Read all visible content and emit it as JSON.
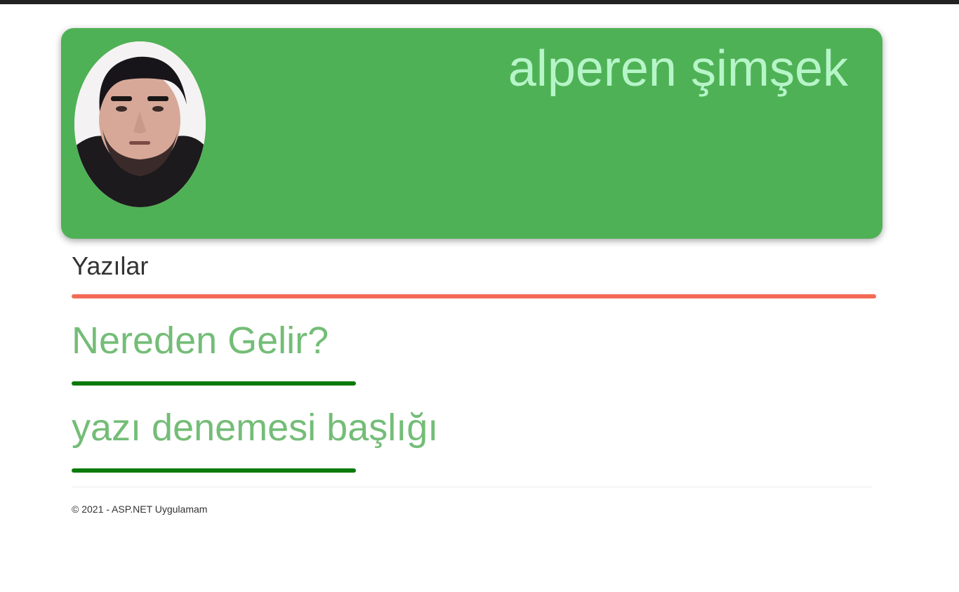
{
  "header": {
    "name": "alperen şimşek",
    "avatar_alt": "profile photo"
  },
  "section": {
    "title": "Yazılar"
  },
  "posts": [
    {
      "title": "Nereden Gelir?"
    },
    {
      "title": "yazı denemesi başlığı"
    }
  ],
  "footer": {
    "text": "© 2021 - ASP.NET Uygulamam"
  },
  "colors": {
    "header_bg": "#4fb155",
    "header_name": "#b6f5c8",
    "section_rule": "#f36b56",
    "post_title": "#74bd77",
    "post_rule": "#0a7a0a"
  }
}
